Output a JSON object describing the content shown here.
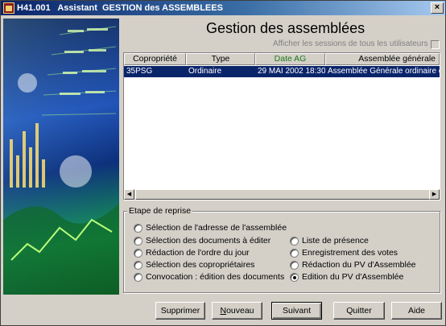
{
  "window": {
    "title": "H41.001   Assistant  GESTION des ASSEMBLEES",
    "close_glyph": "×"
  },
  "header": {
    "title": "Gestion des assemblées",
    "show_all_label": "Afficher les sessions de tous les utilisateurs",
    "show_all_checked": false
  },
  "list": {
    "columns": [
      "Copropriété",
      "Type",
      "Date AG",
      "Assemblée générale"
    ],
    "rows": [
      {
        "copropriete": "35PSG",
        "type": "Ordinaire",
        "date": "29 MAI 2002 18:30",
        "assemblee": "Assemblée Générale ordinaire du",
        "selected": true
      }
    ],
    "scroll_left_glyph": "◀",
    "scroll_right_glyph": "▶"
  },
  "steps": {
    "title": "Etape de reprise",
    "left": [
      {
        "label": "Sélection de l'adresse de l'assemblée",
        "selected": false
      },
      {
        "label": "Sélection des documents à éditer",
        "selected": false
      },
      {
        "label": "Rédaction de l'ordre du jour",
        "selected": false
      },
      {
        "label": "Sélection des copropriétaires",
        "selected": false
      },
      {
        "label": "Convocation : édition des documents",
        "selected": false
      }
    ],
    "right": [
      {
        "label": "Liste de présence",
        "selected": false
      },
      {
        "label": "Enregistrement des votes",
        "selected": false
      },
      {
        "label": "Rédaction du PV d'Assemblée",
        "selected": false
      },
      {
        "label": "Edition du PV d'Assemblée",
        "selected": true
      }
    ]
  },
  "buttons": {
    "delete": "Supprimer",
    "new": "Nouveau",
    "next": "Suivant",
    "quit": "Quitter",
    "help": "Aide"
  },
  "colors": {
    "selection": "#0a246a",
    "date_header": "#1a7a1a"
  }
}
